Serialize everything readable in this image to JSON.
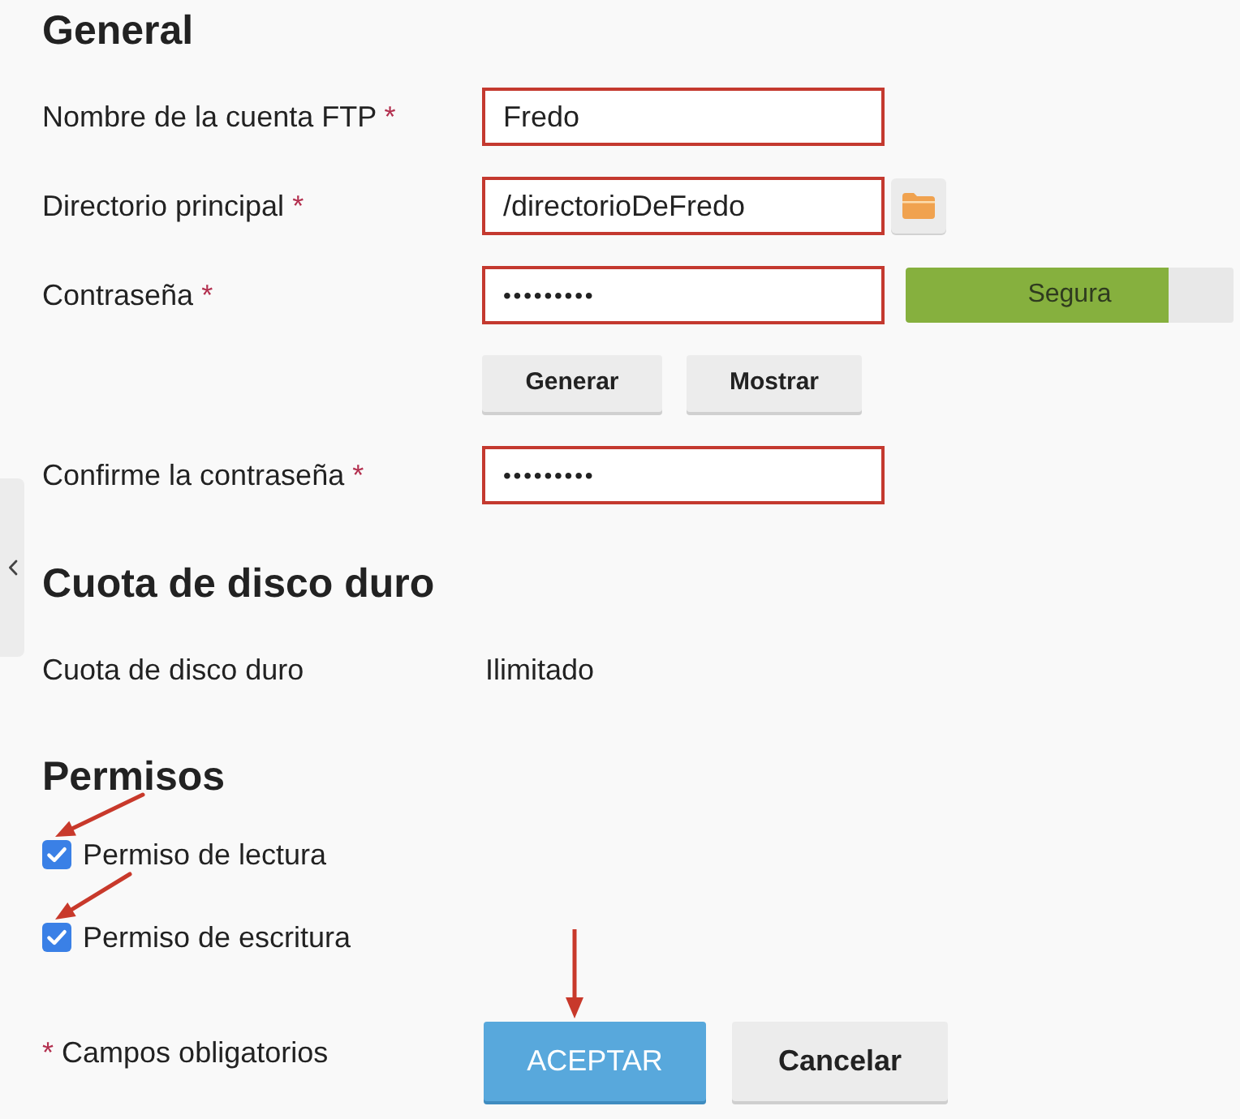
{
  "sections": [
    {
      "kind": "form",
      "title": "General",
      "fields": [
        {
          "kind": "text",
          "label": "Nombre de la cuenta FTP",
          "required_mark": "*",
          "value": "Fredo",
          "outlined": true
        },
        {
          "kind": "folder",
          "label": "Directorio principal",
          "required_mark": "*",
          "value": "/directorioDeFredo",
          "outlined": true
        },
        {
          "kind": "password",
          "label": "Contraseña",
          "required_mark": "*",
          "value": "•••••••••",
          "outlined": true,
          "strength": {
            "label": "Segura",
            "level": 0.8
          },
          "buttons": [
            "Generar",
            "Mostrar"
          ]
        },
        {
          "kind": "password",
          "label": "Confirme la contraseña",
          "required_mark": "*",
          "value": "•••••••••",
          "outlined": true
        }
      ]
    },
    {
      "kind": "info",
      "title": "Cuota de disco duro",
      "rows": [
        {
          "label": "Cuota de disco duro",
          "value": "Ilimitado"
        }
      ]
    },
    {
      "kind": "checks",
      "title": "Permisos",
      "items": [
        {
          "label": "Permiso de lectura",
          "checked": true,
          "arrow": true
        },
        {
          "label": "Permiso de escritura",
          "checked": true,
          "arrow": true
        }
      ]
    }
  ],
  "footer": {
    "required_mark": "*",
    "note": "Campos obligatorios",
    "buttons": [
      {
        "kind": "primary",
        "label": "ACEPTAR",
        "arrow": true
      },
      {
        "kind": "secondary",
        "label": "Cancelar",
        "arrow": false
      }
    ]
  }
}
